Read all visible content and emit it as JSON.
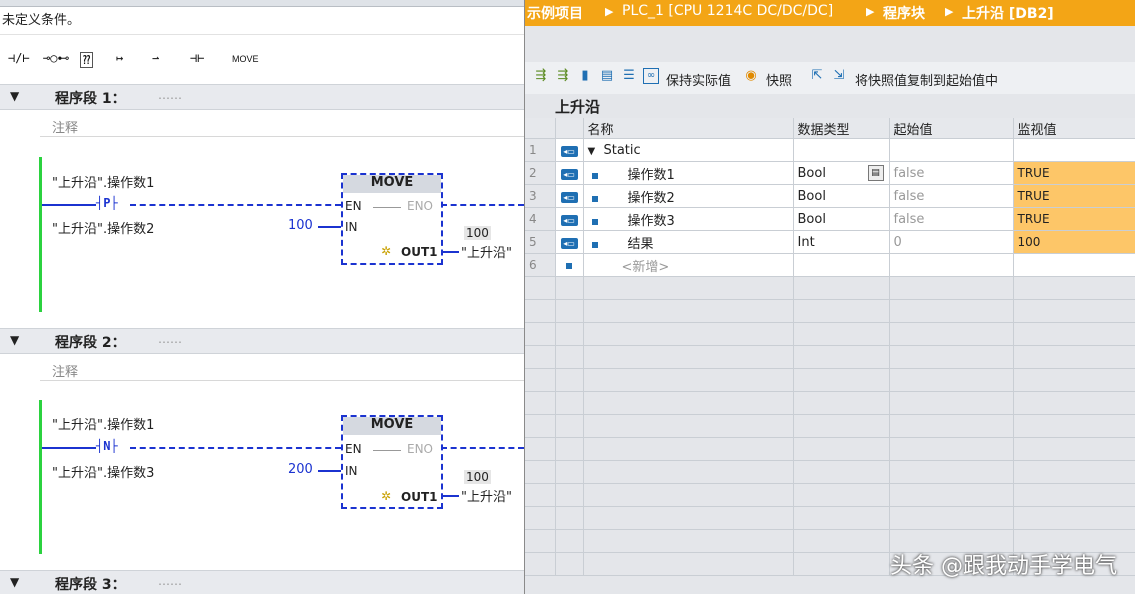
{
  "left": {
    "status": "未定义条件。",
    "toolbar": {
      "instructions": [
        "⊣/⊢",
        "⊸○⊷",
        "⁇",
        "↦",
        "⇀",
        "⊣⊢",
        "MOVE"
      ]
    },
    "segments": [
      {
        "label": "程序段 1：",
        "dots": "……",
        "comment": "注释",
        "var_a": "\"上升沿\".操作数1",
        "edge": "P",
        "var_b": "\"上升沿\".操作数2",
        "in_value": "100",
        "block": "MOVE",
        "pin_en": "EN",
        "pin_eno": "ENO",
        "pin_in": "IN",
        "pin_out": "OUT1",
        "out_value": "100",
        "out_var": "\"上升沿\""
      },
      {
        "label": "程序段 2：",
        "dots": "……",
        "comment": "注释",
        "var_a": "\"上升沿\".操作数1",
        "edge": "N",
        "var_b": "\"上升沿\".操作数3",
        "in_value": "200",
        "block": "MOVE",
        "pin_en": "EN",
        "pin_eno": "ENO",
        "pin_in": "IN",
        "pin_out": "OUT1",
        "out_value": "100",
        "out_var": "\"上升沿\""
      },
      {
        "label": "程序段 3：",
        "dots": "……"
      }
    ]
  },
  "right": {
    "breadcrumb": [
      "示例项目",
      "PLC_1 [CPU 1214C DC/DC/DC]",
      "程序块",
      "上升沿 [DB2]"
    ],
    "toolbar": {
      "keep_actual": "保持实际值",
      "snapshot": "快照",
      "copy_snapshot": "将快照值复制到起始值中"
    },
    "db_title": "上升沿",
    "columns": {
      "name": "名称",
      "type": "数据类型",
      "start": "起始值",
      "monitor": "监视值"
    },
    "rows": [
      {
        "num": "1",
        "name": "Static",
        "type": "",
        "start": "",
        "monitor": ""
      },
      {
        "num": "2",
        "name": "操作数1",
        "type": "Bool",
        "start": "false",
        "monitor": "TRUE"
      },
      {
        "num": "3",
        "name": "操作数2",
        "type": "Bool",
        "start": "false",
        "monitor": "TRUE"
      },
      {
        "num": "4",
        "name": "操作数3",
        "type": "Bool",
        "start": "false",
        "monitor": "TRUE"
      },
      {
        "num": "5",
        "name": "结果",
        "type": "Int",
        "start": "0",
        "monitor": "100"
      },
      {
        "num": "6",
        "name": "<新增>",
        "type": "",
        "start": "",
        "monitor": ""
      }
    ],
    "watermark": "头条 @跟我动手学电气"
  },
  "colors": {
    "breadcrumb_bg": "#f3a516",
    "monitor_bg": "#fdc668",
    "wire": "#1b33d0",
    "power_rail": "#2bd23f"
  }
}
